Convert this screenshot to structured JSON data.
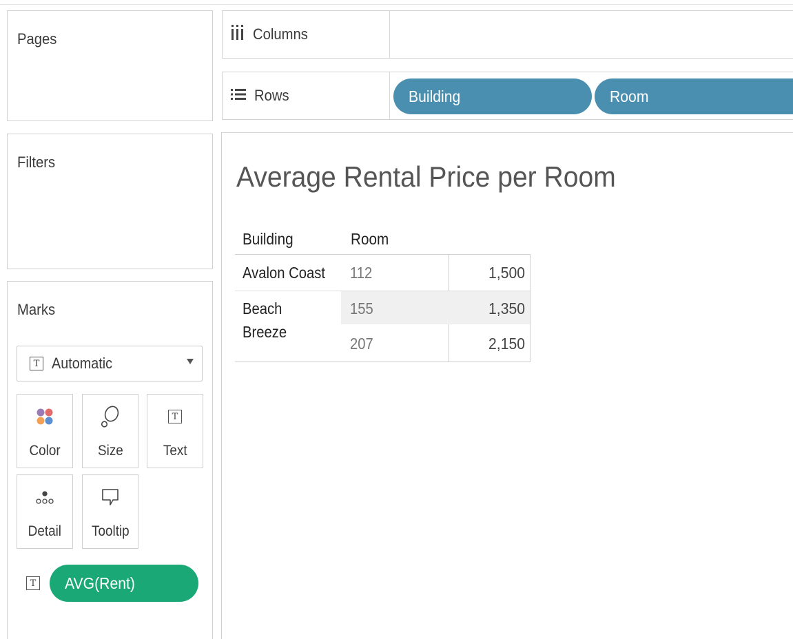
{
  "cards": {
    "pages_title": "Pages",
    "filters_title": "Filters",
    "marks_title": "Marks"
  },
  "shelves": {
    "columns_label": "Columns",
    "rows_label": "Rows",
    "columns_pills": [],
    "rows_pills": [
      "Building",
      "Room"
    ]
  },
  "marks": {
    "mark_type": "Automatic",
    "buttons": [
      "Color",
      "Size",
      "Text",
      "Detail",
      "Tooltip"
    ],
    "field_pill": "AVG(Rent)",
    "field_pill_color": "#1aa877",
    "color_swatches": [
      "#9b7bb5",
      "#e36b6b",
      "#f2a154",
      "#5a8fd1"
    ]
  },
  "view": {
    "title": "Average Rental Price per Room",
    "headers": [
      "Building",
      "Room"
    ],
    "rows": [
      {
        "building": "Avalon Coast",
        "room": "112",
        "value": "1,500"
      },
      {
        "building": "Beach Breeze",
        "room": "155",
        "value": "1,350"
      },
      {
        "building": "",
        "room": "207",
        "value": "2,150"
      }
    ]
  },
  "colors": {
    "dimension_pill": "#4a8fb0",
    "measure_pill": "#1aa877"
  }
}
